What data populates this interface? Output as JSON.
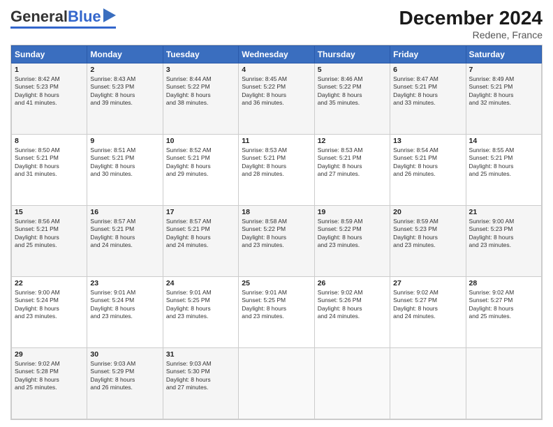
{
  "header": {
    "logo_general": "General",
    "logo_blue": "Blue",
    "title": "December 2024",
    "subtitle": "Redene, France"
  },
  "days_header": [
    "Sunday",
    "Monday",
    "Tuesday",
    "Wednesday",
    "Thursday",
    "Friday",
    "Saturday"
  ],
  "weeks": [
    [
      {
        "day": "1",
        "info": "Sunrise: 8:42 AM\nSunset: 5:23 PM\nDaylight: 8 hours\nand 41 minutes."
      },
      {
        "day": "2",
        "info": "Sunrise: 8:43 AM\nSunset: 5:23 PM\nDaylight: 8 hours\nand 39 minutes."
      },
      {
        "day": "3",
        "info": "Sunrise: 8:44 AM\nSunset: 5:22 PM\nDaylight: 8 hours\nand 38 minutes."
      },
      {
        "day": "4",
        "info": "Sunrise: 8:45 AM\nSunset: 5:22 PM\nDaylight: 8 hours\nand 36 minutes."
      },
      {
        "day": "5",
        "info": "Sunrise: 8:46 AM\nSunset: 5:22 PM\nDaylight: 8 hours\nand 35 minutes."
      },
      {
        "day": "6",
        "info": "Sunrise: 8:47 AM\nSunset: 5:21 PM\nDaylight: 8 hours\nand 33 minutes."
      },
      {
        "day": "7",
        "info": "Sunrise: 8:49 AM\nSunset: 5:21 PM\nDaylight: 8 hours\nand 32 minutes."
      }
    ],
    [
      {
        "day": "8",
        "info": "Sunrise: 8:50 AM\nSunset: 5:21 PM\nDaylight: 8 hours\nand 31 minutes."
      },
      {
        "day": "9",
        "info": "Sunrise: 8:51 AM\nSunset: 5:21 PM\nDaylight: 8 hours\nand 30 minutes."
      },
      {
        "day": "10",
        "info": "Sunrise: 8:52 AM\nSunset: 5:21 PM\nDaylight: 8 hours\nand 29 minutes."
      },
      {
        "day": "11",
        "info": "Sunrise: 8:53 AM\nSunset: 5:21 PM\nDaylight: 8 hours\nand 28 minutes."
      },
      {
        "day": "12",
        "info": "Sunrise: 8:53 AM\nSunset: 5:21 PM\nDaylight: 8 hours\nand 27 minutes."
      },
      {
        "day": "13",
        "info": "Sunrise: 8:54 AM\nSunset: 5:21 PM\nDaylight: 8 hours\nand 26 minutes."
      },
      {
        "day": "14",
        "info": "Sunrise: 8:55 AM\nSunset: 5:21 PM\nDaylight: 8 hours\nand 25 minutes."
      }
    ],
    [
      {
        "day": "15",
        "info": "Sunrise: 8:56 AM\nSunset: 5:21 PM\nDaylight: 8 hours\nand 25 minutes."
      },
      {
        "day": "16",
        "info": "Sunrise: 8:57 AM\nSunset: 5:21 PM\nDaylight: 8 hours\nand 24 minutes."
      },
      {
        "day": "17",
        "info": "Sunrise: 8:57 AM\nSunset: 5:21 PM\nDaylight: 8 hours\nand 24 minutes."
      },
      {
        "day": "18",
        "info": "Sunrise: 8:58 AM\nSunset: 5:22 PM\nDaylight: 8 hours\nand 23 minutes."
      },
      {
        "day": "19",
        "info": "Sunrise: 8:59 AM\nSunset: 5:22 PM\nDaylight: 8 hours\nand 23 minutes."
      },
      {
        "day": "20",
        "info": "Sunrise: 8:59 AM\nSunset: 5:23 PM\nDaylight: 8 hours\nand 23 minutes."
      },
      {
        "day": "21",
        "info": "Sunrise: 9:00 AM\nSunset: 5:23 PM\nDaylight: 8 hours\nand 23 minutes."
      }
    ],
    [
      {
        "day": "22",
        "info": "Sunrise: 9:00 AM\nSunset: 5:24 PM\nDaylight: 8 hours\nand 23 minutes."
      },
      {
        "day": "23",
        "info": "Sunrise: 9:01 AM\nSunset: 5:24 PM\nDaylight: 8 hours\nand 23 minutes."
      },
      {
        "day": "24",
        "info": "Sunrise: 9:01 AM\nSunset: 5:25 PM\nDaylight: 8 hours\nand 23 minutes."
      },
      {
        "day": "25",
        "info": "Sunrise: 9:01 AM\nSunset: 5:25 PM\nDaylight: 8 hours\nand 23 minutes."
      },
      {
        "day": "26",
        "info": "Sunrise: 9:02 AM\nSunset: 5:26 PM\nDaylight: 8 hours\nand 24 minutes."
      },
      {
        "day": "27",
        "info": "Sunrise: 9:02 AM\nSunset: 5:27 PM\nDaylight: 8 hours\nand 24 minutes."
      },
      {
        "day": "28",
        "info": "Sunrise: 9:02 AM\nSunset: 5:27 PM\nDaylight: 8 hours\nand 25 minutes."
      }
    ],
    [
      {
        "day": "29",
        "info": "Sunrise: 9:02 AM\nSunset: 5:28 PM\nDaylight: 8 hours\nand 25 minutes."
      },
      {
        "day": "30",
        "info": "Sunrise: 9:03 AM\nSunset: 5:29 PM\nDaylight: 8 hours\nand 26 minutes."
      },
      {
        "day": "31",
        "info": "Sunrise: 9:03 AM\nSunset: 5:30 PM\nDaylight: 8 hours\nand 27 minutes."
      },
      {
        "day": "",
        "info": ""
      },
      {
        "day": "",
        "info": ""
      },
      {
        "day": "",
        "info": ""
      },
      {
        "day": "",
        "info": ""
      }
    ]
  ]
}
